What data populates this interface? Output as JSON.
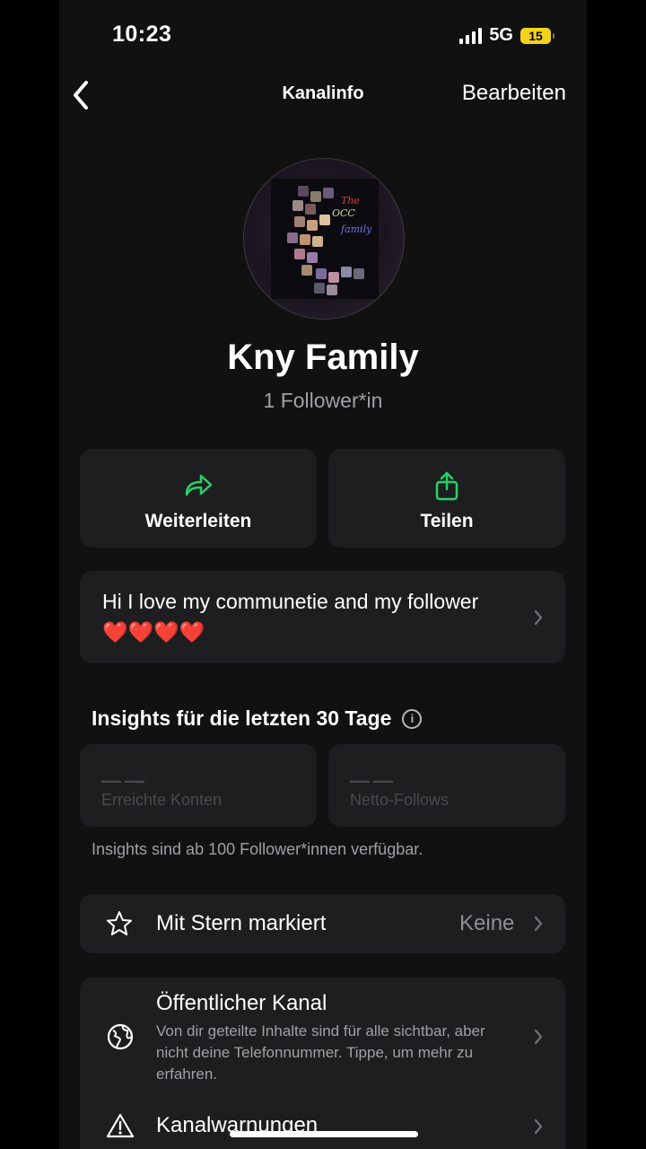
{
  "status_bar": {
    "time": "10:23",
    "network": "5G",
    "battery": "15"
  },
  "nav": {
    "back_icon": "chevron-left-icon",
    "title": "Kanalinfo",
    "edit_label": "Bearbeiten"
  },
  "channel": {
    "name": "Kny Family",
    "followers": "1 Follower*in",
    "avatar_text": [
      "The",
      "OCC",
      "family"
    ]
  },
  "actions": [
    {
      "label": "Weiterleiten",
      "icon": "forward-arrow-icon"
    },
    {
      "label": "Teilen",
      "icon": "share-icon"
    }
  ],
  "description": {
    "text": "Hi I love my communetie and my follower ❤️❤️❤️❤️"
  },
  "insights": {
    "title": "Insights für die letzten 30 Tage",
    "cards": [
      {
        "value": "——",
        "label": "Erreichte Konten"
      },
      {
        "value": "——",
        "label": "Netto-Follows"
      }
    ],
    "note": "Insights sind ab 100 Follower*innen verfügbar."
  },
  "starred": {
    "label": "Mit Stern markiert",
    "value": "Keine",
    "icon": "star-icon"
  },
  "public_channel": {
    "title": "Öffentlicher Kanal",
    "subtitle": "Von dir geteilte Inhalte sind für alle sichtbar, aber nicht deine Telefonnummer. Tippe, um mehr zu erfahren.",
    "icon": "globe-icon"
  },
  "warnings": {
    "label": "Kanalwarnungen",
    "icon": "warning-icon"
  },
  "colors": {
    "accent_green": "#25d366",
    "background": "#111112",
    "card": "#1e1e20",
    "battery": "#f3d21c"
  }
}
